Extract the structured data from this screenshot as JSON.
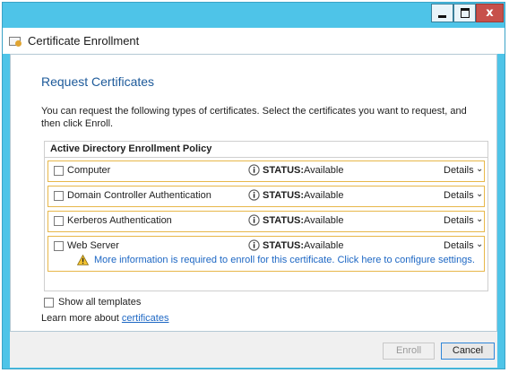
{
  "window": {
    "title": "Certificate Enrollment",
    "controls": {
      "minimize": "minimize",
      "maximize": "maximize",
      "close": "x"
    }
  },
  "page": {
    "heading": "Request Certificates",
    "intro": "You can request the following types of certificates. Select the certificates you want to request, and then click Enroll."
  },
  "policy": {
    "title": "Active Directory Enrollment Policy",
    "status_label": "STATUS:",
    "details_label": "Details",
    "certificates": [
      {
        "name": "Computer",
        "status": "Available",
        "checked": false
      },
      {
        "name": "Domain Controller Authentication",
        "status": "Available",
        "checked": false
      },
      {
        "name": "Kerberos Authentication",
        "status": "Available",
        "checked": false
      },
      {
        "name": "Web Server",
        "status": "Available",
        "checked": false,
        "warning": "More information is required to enroll for this certificate. Click here to configure settings."
      }
    ]
  },
  "options": {
    "show_all_templates": "Show all templates",
    "learn_more_prefix": "Learn more about",
    "learn_more_link": "certificates"
  },
  "footer": {
    "enroll": "Enroll",
    "cancel": "Cancel"
  },
  "colors": {
    "accent_frame": "#4ec4e8",
    "heading_blue": "#1d5a9a",
    "link_blue": "#1d67c4",
    "row_border": "#e7b74a",
    "close_red": "#c7504b"
  }
}
